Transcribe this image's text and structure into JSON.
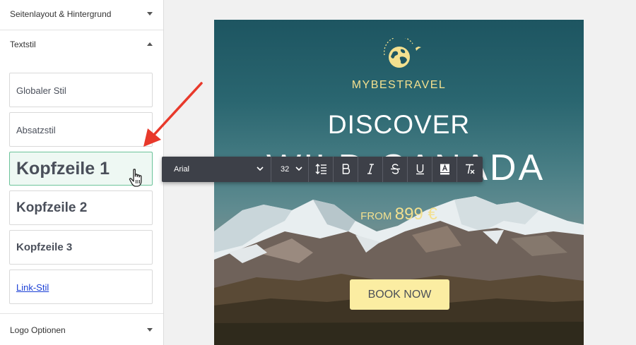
{
  "sidebar": {
    "sections": [
      {
        "title": "Seitenlayout & Hintergrund",
        "state": "collapsed"
      },
      {
        "title": "Textstil",
        "state": "expanded"
      },
      {
        "title": "Logo Optionen",
        "state": "collapsed"
      }
    ],
    "text_styles": [
      {
        "label": "Globaler Stil"
      },
      {
        "label": "Absatzstil"
      },
      {
        "label": "Kopfzeile 1",
        "selected": true
      },
      {
        "label": "Kopfzeile 2"
      },
      {
        "label": "Kopfzeile 3"
      },
      {
        "label": "Link-Stil"
      }
    ]
  },
  "toolbar": {
    "font": "Arial",
    "size": "32",
    "buttons": [
      "line-height-icon",
      "bold-icon",
      "italic-icon",
      "strikethrough-icon",
      "underline-icon",
      "text-color-icon",
      "clear-format-icon"
    ]
  },
  "email": {
    "brand": "MYBESTRAVEL",
    "headline1": "DISCOVER",
    "headline2": "WILD CANADA",
    "price_prefix": "FROM",
    "price": "899 €",
    "cta": "BOOK NOW"
  },
  "colors": {
    "accent_selected_border": "#6cc39a",
    "selected_bg": "#eef8f3",
    "link": "#1a3fd6",
    "brand_yellow": "#f3e08f",
    "button_bg": "#fbeda2",
    "toolbar_bg": "#3d4048",
    "arrow": "#e8392b"
  }
}
